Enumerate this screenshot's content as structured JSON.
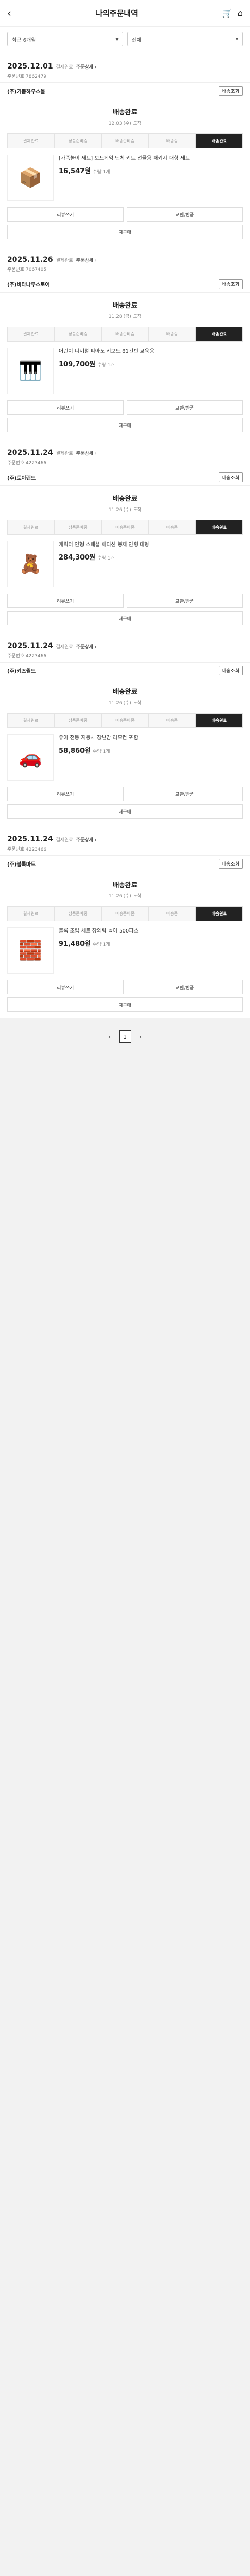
{
  "header": {
    "back": "‹",
    "title": "나의주문내역",
    "cart": "🛒",
    "menu": "⌂"
  },
  "filters": {
    "period": "최근 6개월",
    "type": "전체"
  },
  "orders": [
    {
      "date": "2025.12.01",
      "small": "결제완료",
      "detail": "주문상세 ›",
      "no": "주문번호 7862479",
      "store": "(주)기쁨하우스몰",
      "status": "배송완료",
      "sub": "12.03 (수) 도착",
      "btn": "배송조회",
      "steps": [
        "결제완료",
        "상품준비중",
        "배송준비중",
        "배송중",
        "배송완료"
      ],
      "active": 4,
      "item": {
        "icon": "📦",
        "name": "[가족놀이 세트] 보드게임 단체 키트 선물용 패키지 대형 세트",
        "price": "16,547원",
        "qty": "수량 1개"
      },
      "b1": "리뷰쓰기",
      "b2": "교환/반품",
      "b3": "재구매"
    },
    {
      "date": "2025.11.26",
      "small": "결제완료",
      "detail": "주문상세 ›",
      "no": "주문번호 7067405",
      "store": "(주)비타나무스토어",
      "status": "배송완료",
      "sub": "11.28 (금) 도착",
      "btn": "배송조회",
      "steps": [
        "결제완료",
        "상품준비중",
        "배송준비중",
        "배송중",
        "배송완료"
      ],
      "active": 4,
      "item": {
        "icon": "🎹",
        "name": "어린이 디지털 피아노 키보드 61건반 교육용",
        "price": "109,700원",
        "qty": "수량 1개"
      },
      "b1": "리뷰쓰기",
      "b2": "교환/반품",
      "b3": "재구매"
    },
    {
      "date": "2025.11.24",
      "small": "결제완료",
      "detail": "주문상세 ›",
      "no": "주문번호 4223466",
      "store": "(주)토이랜드",
      "status": "배송완료",
      "sub": "11.26 (수) 도착",
      "btn": "배송조회",
      "steps": [
        "결제완료",
        "상품준비중",
        "배송준비중",
        "배송중",
        "배송완료"
      ],
      "active": 4,
      "item": {
        "icon": "🧸",
        "name": "캐릭터 인형 스페셜 에디션 봉제 인형 대형",
        "price": "284,300원",
        "qty": "수량 1개"
      },
      "b1": "리뷰쓰기",
      "b2": "교환/반품",
      "b3": "재구매"
    },
    {
      "date": "2025.11.24",
      "small": "결제완료",
      "detail": "주문상세 ›",
      "no": "주문번호 4223466",
      "store": "(주)키즈월드",
      "status": "배송완료",
      "sub": "11.26 (수) 도착",
      "btn": "배송조회",
      "steps": [
        "결제완료",
        "상품준비중",
        "배송준비중",
        "배송중",
        "배송완료"
      ],
      "active": 4,
      "item": {
        "icon": "🚗",
        "name": "유아 전동 자동차 장난감 리모컨 포함",
        "price": "58,860원",
        "qty": "수량 1개"
      },
      "b1": "리뷰쓰기",
      "b2": "교환/반품",
      "b3": "재구매"
    },
    {
      "date": "2025.11.24",
      "small": "결제완료",
      "detail": "주문상세 ›",
      "no": "주문번호 4223466",
      "store": "(주)블록마트",
      "status": "배송완료",
      "sub": "11.26 (수) 도착",
      "btn": "배송조회",
      "steps": [
        "결제완료",
        "상품준비중",
        "배송준비중",
        "배송중",
        "배송완료"
      ],
      "active": 4,
      "item": {
        "icon": "🧱",
        "name": "블록 조립 세트 창의력 놀이 500피스",
        "price": "91,480원",
        "qty": "수량 1개"
      },
      "b1": "리뷰쓰기",
      "b2": "교환/반품",
      "b3": "재구매"
    }
  ],
  "pager": {
    "prev": "‹",
    "page": "1",
    "next": "›"
  }
}
